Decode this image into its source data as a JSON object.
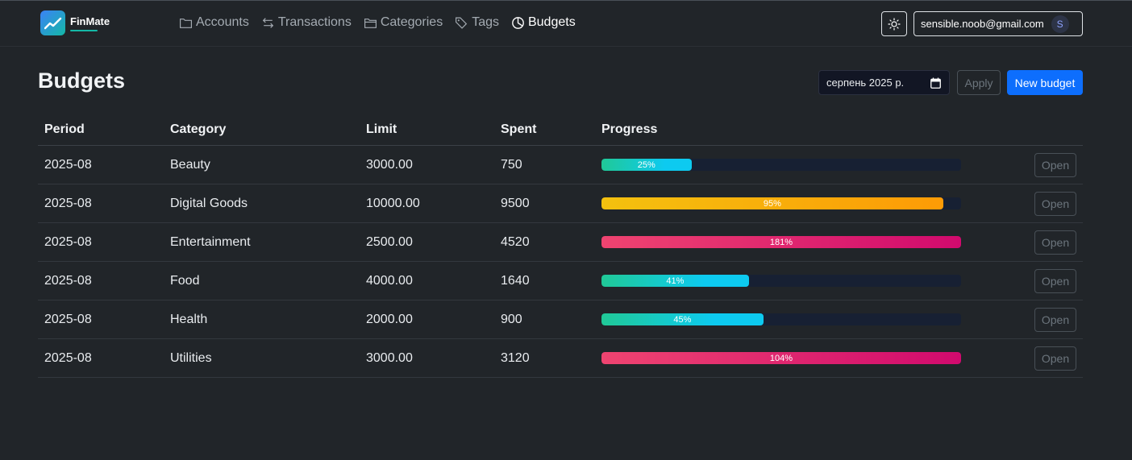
{
  "brand": {
    "name": "FinMate"
  },
  "nav": [
    {
      "label": "Accounts",
      "icon": "folder-icon",
      "active": false
    },
    {
      "label": "Transactions",
      "icon": "arrows-swap-icon",
      "active": false
    },
    {
      "label": "Categories",
      "icon": "folder-open-icon",
      "active": false
    },
    {
      "label": "Tags",
      "icon": "tags-icon",
      "active": false
    },
    {
      "label": "Budgets",
      "icon": "pie-chart-icon",
      "active": true
    }
  ],
  "header": {
    "theme_icon": "sun-icon",
    "user_email": "sensible.noob@gmail.com",
    "avatar_initial": "S"
  },
  "page": {
    "title": "Budgets",
    "month_value": "серпень 2025 р.",
    "apply_label": "Apply",
    "new_label": "New budget"
  },
  "table": {
    "headers": [
      "Period",
      "Category",
      "Limit",
      "Spent",
      "Progress"
    ],
    "open_label": "Open",
    "rows": [
      {
        "period": "2025-08",
        "category": "Beauty",
        "limit": "3000.00",
        "spent": "750",
        "progress_label": "25%",
        "progress": 25,
        "status": "ok"
      },
      {
        "period": "2025-08",
        "category": "Digital Goods",
        "limit": "10000.00",
        "spent": "9500",
        "progress_label": "95%",
        "progress": 95,
        "status": "warn"
      },
      {
        "period": "2025-08",
        "category": "Entertainment",
        "limit": "2500.00",
        "spent": "4520",
        "progress_label": "181%",
        "progress": 181,
        "status": "over"
      },
      {
        "period": "2025-08",
        "category": "Food",
        "limit": "4000.00",
        "spent": "1640",
        "progress_label": "41%",
        "progress": 41,
        "status": "ok"
      },
      {
        "period": "2025-08",
        "category": "Health",
        "limit": "2000.00",
        "spent": "900",
        "progress_label": "45%",
        "progress": 45,
        "status": "ok"
      },
      {
        "period": "2025-08",
        "category": "Utilities",
        "limit": "3000.00",
        "spent": "3120",
        "progress_label": "104%",
        "progress": 104,
        "status": "over"
      }
    ]
  },
  "colors": {
    "background": "#212529",
    "primary": "#0d6efd",
    "progress_ok": "#20c997",
    "progress_warn": "#fd9b06",
    "progress_over": "#d10a6e"
  }
}
